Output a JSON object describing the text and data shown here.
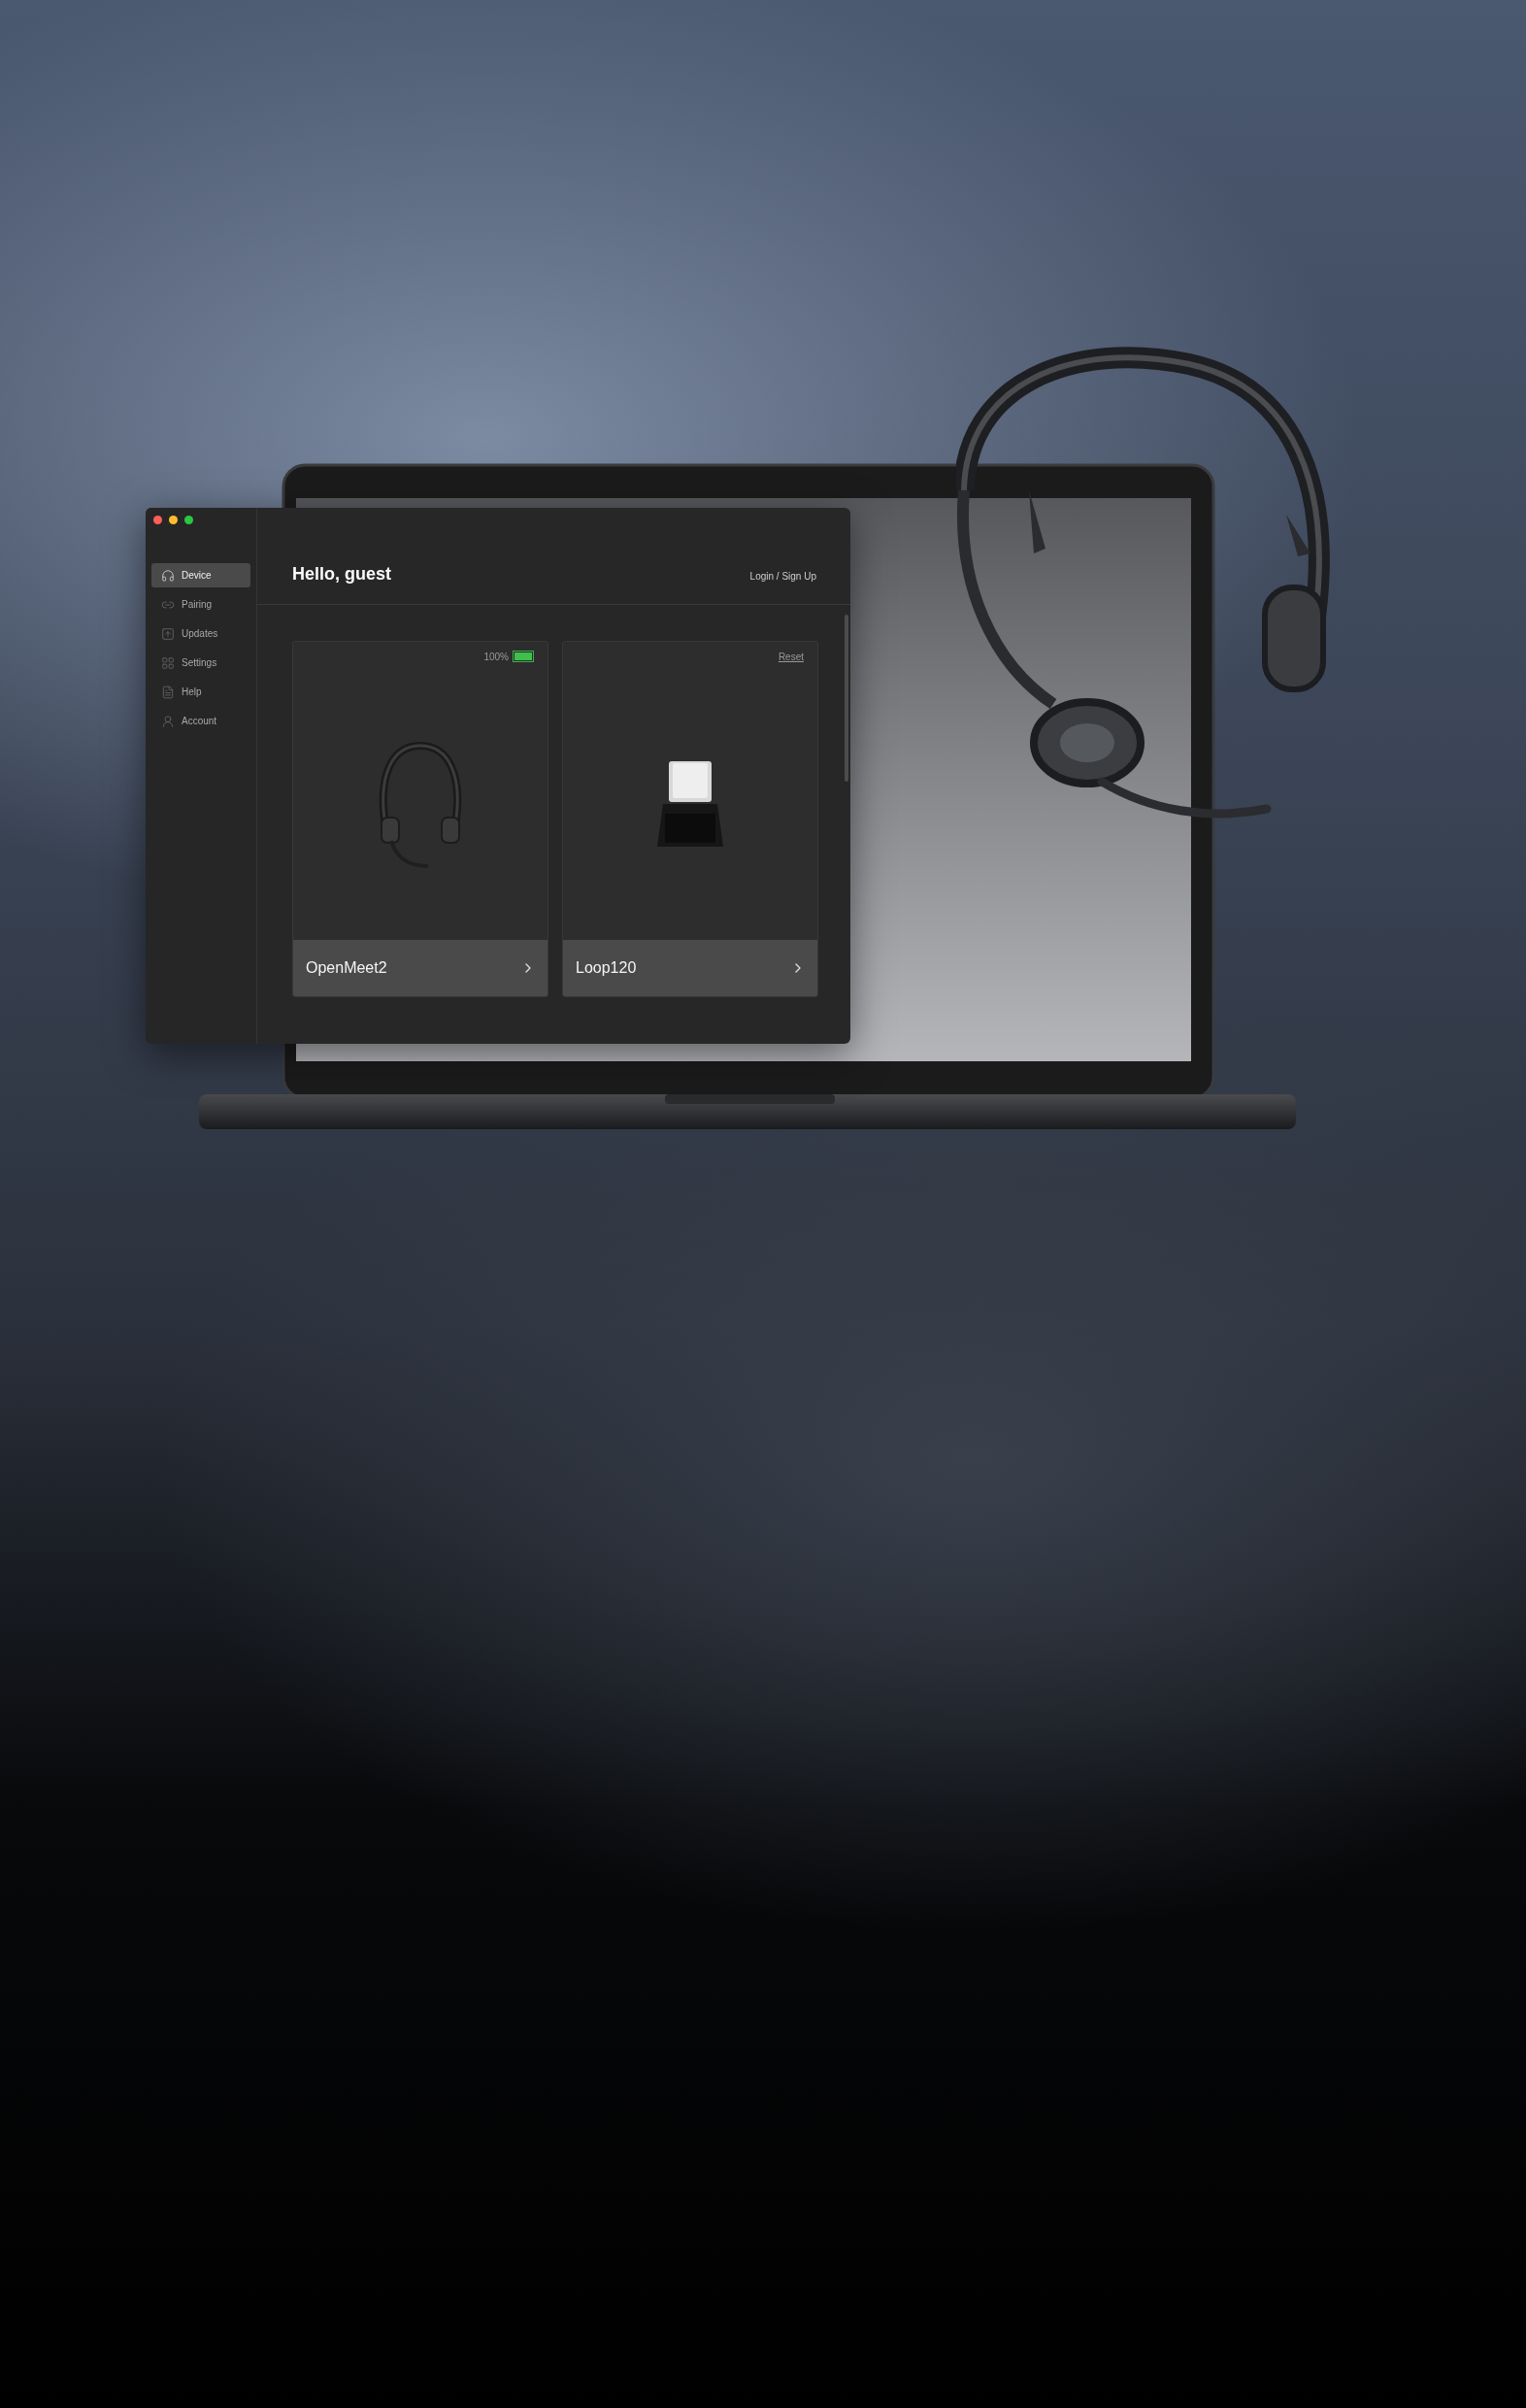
{
  "sidebar": {
    "items": [
      {
        "label": "Device",
        "selected": true
      },
      {
        "label": "Pairing",
        "selected": false
      },
      {
        "label": "Updates",
        "selected": false
      },
      {
        "label": "Settings",
        "selected": false
      },
      {
        "label": "Help",
        "selected": false
      },
      {
        "label": "Account",
        "selected": false
      }
    ]
  },
  "header": {
    "greeting": "Hello, guest",
    "login_link": "Login / Sign Up"
  },
  "devices": [
    {
      "kind": "headset",
      "name": "OpenMeet2",
      "battery": {
        "reading": "100%",
        "level": 1
      }
    },
    {
      "kind": "dongle",
      "name": "Loop120",
      "action": "Reset"
    }
  ]
}
